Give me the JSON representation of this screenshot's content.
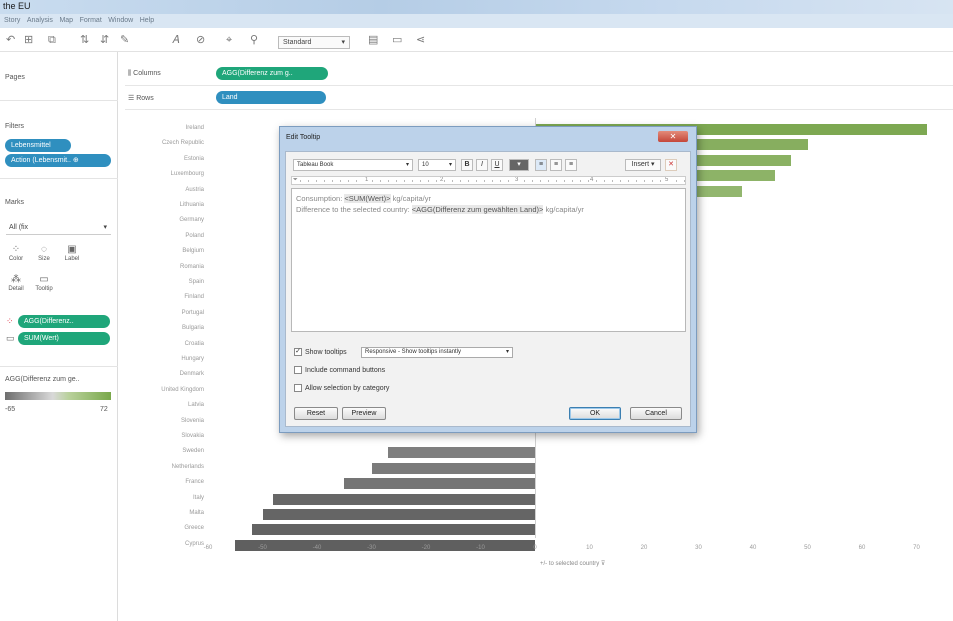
{
  "window": {
    "title": "the EU"
  },
  "menu": [
    "Story",
    "Analysis",
    "Map",
    "Format",
    "Window",
    "Help"
  ],
  "toolbar": {
    "fit_select": "Standard",
    "icons": [
      "undo-icon",
      "data-icon",
      "duplicate-icon",
      "swap-icon",
      "sort-icon",
      "highlight-icon",
      "label-icon",
      "group-icon",
      "pin-icon",
      "chart-icon",
      "tooltip-icon",
      "share-icon"
    ]
  },
  "left_panel": {
    "pages_label": "Pages",
    "filters_label": "Filters",
    "filters": [
      "Lebensmittel",
      "Action (Lebensmit.. ⊕"
    ],
    "marks_label": "Marks",
    "mark_type": "All (fix",
    "mark_buttons": [
      {
        "label": "Color",
        "icon": "color-icon"
      },
      {
        "label": "Size",
        "icon": "size-icon"
      },
      {
        "label": "Label",
        "icon": "label-icon"
      },
      {
        "label": "Detail",
        "icon": "detail-icon"
      },
      {
        "label": "Tooltip",
        "icon": "tooltip-icon"
      }
    ],
    "mark_pills": [
      "AGG(Differenz..",
      "SUM(Wert)"
    ],
    "legend_title": "AGG(Differenz zum ge..",
    "legend_min": "-65",
    "legend_max": "72"
  },
  "shelves": {
    "columns_label": "Columns",
    "columns_pill": "AGG(Differenz zum g..",
    "rows_label": "Rows",
    "rows_pill": "Land"
  },
  "chart_data": {
    "type": "bar",
    "orientation": "horizontal",
    "categories": [
      "Ireland",
      "Czech Republic",
      "Estonia",
      "Luxembourg",
      "Austria",
      "Lithuania",
      "Germany",
      "Poland",
      "Belgium",
      "Romania",
      "Spain",
      "Finland",
      "Portugal",
      "Bulgaria",
      "Croatia",
      "Hungary",
      "Denmark",
      "United Kingdom",
      "Latvia",
      "Slovenia",
      "Slovakia",
      "Sweden",
      "Netherlands",
      "France",
      "Italy",
      "Malta",
      "Greece",
      "Cyprus"
    ],
    "values": [
      72,
      50,
      47,
      44,
      38,
      null,
      null,
      null,
      null,
      null,
      null,
      null,
      null,
      null,
      null,
      null,
      null,
      null,
      null,
      null,
      null,
      -27,
      -30,
      -35,
      -48,
      -50,
      -52,
      -55
    ],
    "x_ticks": [
      "-60",
      "-50",
      "-40",
      "-30",
      "-20",
      "-10",
      "0",
      "10",
      "20",
      "30",
      "40",
      "50",
      "60",
      "70"
    ],
    "xlim": [
      -60,
      72
    ],
    "xlabel": "+/- to selected country",
    "colors": {
      "positive": "#9dbd7a",
      "negative": "#7a7a7a"
    }
  },
  "dialog": {
    "title": "Edit Tooltip",
    "close": "✕",
    "font": "Tableau Book",
    "size": "10",
    "format_buttons": [
      "B",
      "I",
      "U"
    ],
    "insert_label": "Insert ▾",
    "ruler_marks": [
      "1",
      "2",
      "3",
      "4",
      "5"
    ],
    "line1_label": "Consumption:",
    "line1_field": "<SUM(Wert)>",
    "line1_unit": "kg/capita/yr",
    "line2_label": "Difference to the selected country:",
    "line2_field": "<AGG(Differenz zum gewählten Land)>",
    "line2_unit": "kg/capita/yr",
    "show_tooltip": "Show tooltips",
    "show_tooltip_checked": "✓",
    "tooltip_mode": "Responsive - Show tooltips instantly",
    "include_buttons": "Include command buttons",
    "allow_selection": "Allow selection by category",
    "reset": "Reset",
    "preview": "Preview",
    "ok": "OK",
    "cancel": "Cancel"
  }
}
